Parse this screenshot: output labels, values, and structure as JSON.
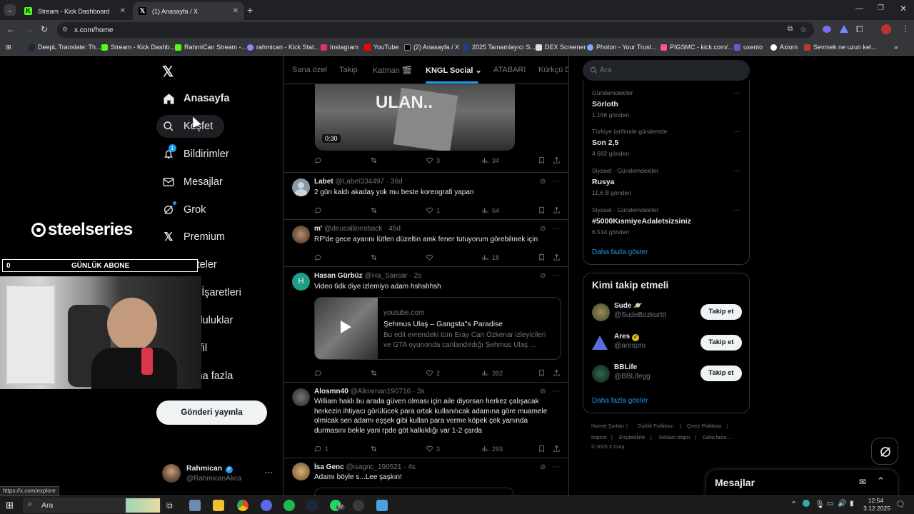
{
  "browser": {
    "tabs": [
      {
        "title": "Stream - Kick Dashboard"
      },
      {
        "title": "(1) Anasayfa / X"
      }
    ],
    "url": "x.com/home",
    "bookmarks": [
      {
        "label": "DeepL Translate: Th..."
      },
      {
        "label": "Stream - Kick Dashb..."
      },
      {
        "label": "RahmiCan Stream -..."
      },
      {
        "label": "rahmican - Kick Stat..."
      },
      {
        "label": "Instagram"
      },
      {
        "label": "YouTube"
      },
      {
        "label": "(2) Anasayfa / X"
      },
      {
        "label": "2025 Tamamlayıcı S..."
      },
      {
        "label": "DEX Screener"
      },
      {
        "label": "Photon - Your Trust..."
      },
      {
        "label": "PIGSMC - kick.com/..."
      },
      {
        "label": "uxento"
      },
      {
        "label": "Axiom"
      },
      {
        "label": "Sevmek ne uzun kel..."
      }
    ],
    "status_url": "https://x.com/explore"
  },
  "nav": {
    "items": [
      {
        "label": "Anasayfa"
      },
      {
        "label": "Keşfet"
      },
      {
        "label": "Bildirimler"
      },
      {
        "label": "Mesajlar"
      },
      {
        "label": "Grok"
      },
      {
        "label": "Premium"
      },
      {
        "label": "Listeler"
      },
      {
        "label": "Yer İşaretleri"
      },
      {
        "label": "Topluluklar"
      },
      {
        "label": "Profil"
      },
      {
        "label": "Daha fazla"
      }
    ],
    "notif_count": "1",
    "post_button": "Gönderi yayınla",
    "profile": {
      "name": "Rahmican",
      "handle": "@RahmicanAkca"
    }
  },
  "overlay": {
    "brand": "steelseries",
    "counter_value": "0",
    "counter_label": "GÜNLÜK ABONE"
  },
  "center": {
    "tabs": [
      {
        "label": "Sana özel"
      },
      {
        "label": "Takip"
      },
      {
        "label": "Katman 🎬"
      },
      {
        "label": "KNGL Social"
      },
      {
        "label": "ATABARI"
      },
      {
        "label": "Kürkçü D"
      }
    ],
    "video_caption": "ULAN..",
    "video_time": "0:30",
    "posts": [
      {
        "name": "",
        "handle": "",
        "time": "",
        "text": "",
        "replies": "",
        "likes": "3",
        "views": "34"
      },
      {
        "name": "Labet",
        "handle": "@Labet334497",
        "time": "· 36d",
        "text": "2 gün kaldı akadaş yok mu beste koreografi yapan",
        "likes": "1",
        "views": "54"
      },
      {
        "name": "m'",
        "handle": "@deucallionsback",
        "time": "· 45d",
        "text": "RP'de gece ayarını lütfen düzeltin amk fener tutuyorum görebilmek için",
        "likes": "",
        "views": "18"
      },
      {
        "name": "Hasan Gürbüz",
        "handle": "@Ha_Sansar",
        "time": "· 2s",
        "text": "Video 6dk diye izlemiyo adam hshshhsh",
        "likes": "2",
        "views": "392"
      },
      {
        "name": "Alosmn40",
        "handle": "@Aliosman190716",
        "time": "· 3s",
        "text": "William haklı bu arada güven olması için aile diyorsan herkez çalışacak herkezin ihtiyacı görülücek para ortak kullanılıcak adamına göre muamele olmicak sen adamı eşşek gibi kullan para verme köpek çek yanında durmasını bekle yani rpde göt kalkıklığı var 1-2 çarda",
        "replies": "1",
        "likes": "3",
        "views": "293"
      },
      {
        "name": "İsa Genc",
        "handle": "@isagnc_190521",
        "time": "· 4s",
        "text": "Adamı böyle s...Lee şaşkın!"
      }
    ],
    "link_card": {
      "domain": "youtube.com",
      "title": "Şehmus Ulaş – Gangsta\"s Paradise",
      "desc": "Bu edit evrendeki tüm Eray Can Özkenar izleyicileri ve GTA oyunonda canlandırdığı Şehmus Ulaş ..."
    }
  },
  "right": {
    "search_placeholder": "Ara",
    "trends": [
      {
        "context": "Gündemdekiler",
        "name": "Sörloth",
        "count": "1.156 gönderi"
      },
      {
        "context": "Türkiye tarihinde gündemde",
        "name": "Son 2,5",
        "count": "4.682 gönderi"
      },
      {
        "context": "Siyaset · Gündemdekiler",
        "name": "Rusya",
        "count": "11,6 B gönderi"
      },
      {
        "context": "Siyaset · Gündemdekiler",
        "name": "#5000KısmiyeAdaletsizsiniz",
        "count": "6.514 gönderi"
      }
    ],
    "show_more": "Daha fazla göster",
    "who_title": "Kimi takip etmeli",
    "who": [
      {
        "name": "Sude 🪐",
        "handle": "@SudeBozkurttt",
        "button": "Takip et"
      },
      {
        "name": "Ares",
        "handle": "@arespro",
        "button": "Takip et"
      },
      {
        "name": "BBLife",
        "handle": "@BBLifegg",
        "button": "Takip et"
      }
    ],
    "who_more": "Daha fazla göster",
    "footer": [
      "Hizmet Şartları",
      "Gizlilik Politikası",
      "Çerez Politikası",
      "Imprint",
      "Erişilebilirlik",
      "Reklam bilgisi",
      "Daha fazla ...",
      "© 2025 X Corp."
    ],
    "messages_title": "Mesajlar"
  },
  "taskbar": {
    "search": "Ara",
    "whatsapp_badge": "67",
    "time": "12:54",
    "date": "3.12.2025"
  }
}
